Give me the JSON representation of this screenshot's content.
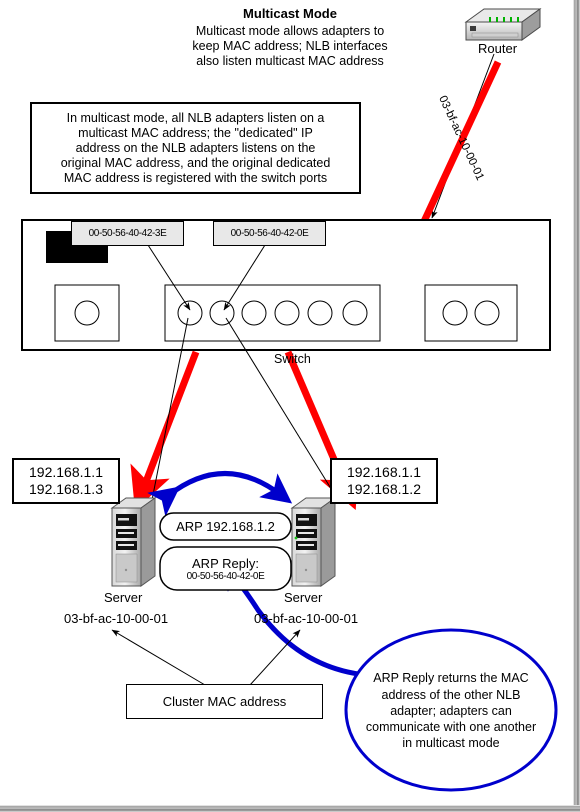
{
  "diagram": {
    "title": "Multicast Mode",
    "subtitle_lines": [
      "Multicast mode allows adapters to",
      "keep MAC address; NLB interfaces",
      "also listen multicast MAC address"
    ],
    "description_box": [
      "In multicast mode, all NLB adapters listen on a",
      "multicast MAC address; the \"dedicated\" IP",
      "address on the NLB adapters listens on the",
      "original MAC address, and the original dedicated",
      "MAC address is registered with the switch ports"
    ]
  },
  "router": {
    "label": "Router",
    "icon": "router-icon"
  },
  "multicast_mac_trace": {
    "label": "03-bf-ac-10-00-01"
  },
  "switch": {
    "label": "Switch",
    "port_mac_labels": [
      "00-50-56-40-42-3E",
      "00-50-56-40-42-0E"
    ],
    "port_count_center": 6,
    "port_count_left": 1,
    "port_count_right": 2
  },
  "servers": [
    {
      "label": "Server",
      "ip_lines": [
        "192.168.1.1",
        "192.168.1.3"
      ],
      "cluster_mac": "03-bf-ac-10-00-01"
    },
    {
      "label": "Server",
      "ip_lines": [
        "192.168.1.1",
        "192.168.1.2"
      ],
      "cluster_mac": "03-bf-ac-10-00-01"
    }
  ],
  "arp_bubbles": [
    {
      "line1": "ARP 192.168.1.2"
    },
    {
      "line1": "ARP Reply:",
      "line2": "00-50-56-40-42-0E"
    }
  ],
  "cluster_mac_box": {
    "label": "Cluster MAC address"
  },
  "callout": {
    "lines": [
      "ARP Reply returns the MAC",
      "address of the other NLB",
      "adapter; adapters can",
      "communicate with one another",
      "in multicast mode"
    ]
  },
  "colors": {
    "multicast_traffic": "#ff0000",
    "arp_traffic": "#0000cc",
    "outline": "#000000",
    "mac_label_bg": "#e8e8e8"
  }
}
